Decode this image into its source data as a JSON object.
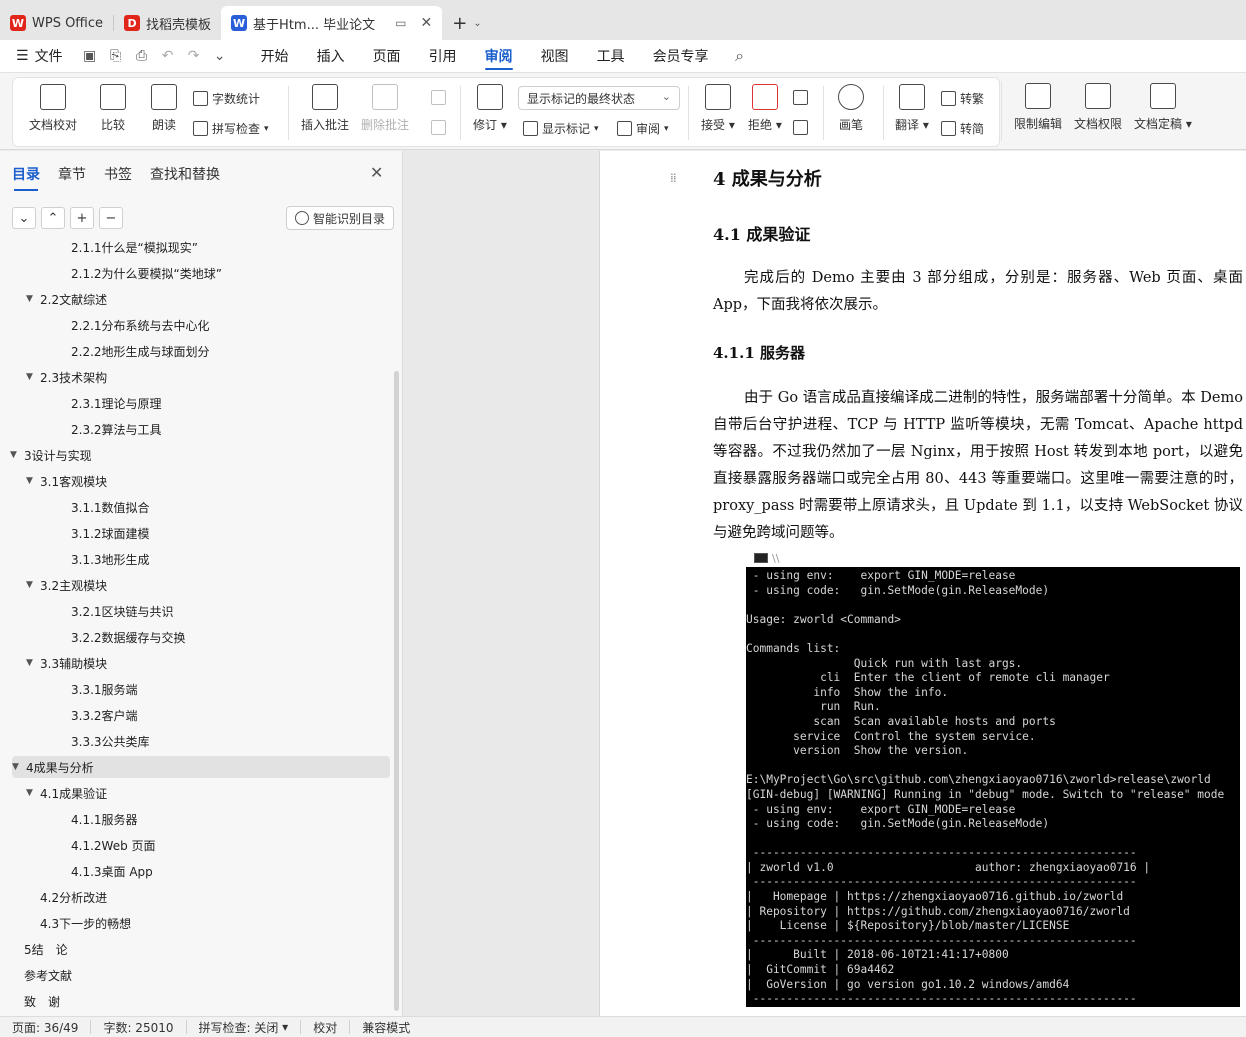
{
  "tabs": [
    {
      "label": "WPS Office",
      "logo": "W",
      "logo_color": "#e1251b"
    },
    {
      "label": "找稻壳模板",
      "logo": "D",
      "logo_color": "#e1251b"
    },
    {
      "label": "基于Htm... 毕业论文",
      "logo": "W",
      "logo_color": "#2b5fd9"
    }
  ],
  "menu": {
    "file": "文件",
    "items": [
      "开始",
      "插入",
      "页面",
      "引用",
      "审阅",
      "视图",
      "工具",
      "会员专享"
    ],
    "active": "审阅"
  },
  "ribbon": {
    "doc_check": "文档校对",
    "compare": "比较",
    "read_aloud": "朗读",
    "word_count": "字数统计",
    "spell_check": "拼写检查",
    "insert_comment": "插入批注",
    "delete_comment": "删除批注",
    "revise": "修订",
    "markup_state": "显示标记的最终状态",
    "show_markup": "显示标记",
    "review": "审阅",
    "accept": "接受",
    "reject": "拒绝",
    "pen": "画笔",
    "translate": "翻译",
    "to_traditional": "转繁",
    "to_simplified": "转简",
    "restrict_edit": "限制编辑",
    "doc_permission": "文档权限",
    "doc_finalize": "文档定稿"
  },
  "nav": {
    "tabs": [
      "目录",
      "章节",
      "书签",
      "查找和替换"
    ],
    "smart_toc": "智能识别目录",
    "toc": [
      {
        "label": "2.1.1什么是“模拟现实”",
        "level": 3
      },
      {
        "label": "2.1.2为什么要模拟“类地球”",
        "level": 3
      },
      {
        "label": "2.2文献综述",
        "level": 2
      },
      {
        "label": "2.2.1分布系统与去中心化",
        "level": 3
      },
      {
        "label": "2.2.2地形生成与球面划分",
        "level": 3
      },
      {
        "label": "2.3技术架构",
        "level": 2
      },
      {
        "label": "2.3.1理论与原理",
        "level": 3
      },
      {
        "label": "2.3.2算法与工具",
        "level": 3
      },
      {
        "label": "3设计与实现",
        "level": 1
      },
      {
        "label": "3.1客观模块",
        "level": 2
      },
      {
        "label": "3.1.1数值拟合",
        "level": 3
      },
      {
        "label": "3.1.2球面建模",
        "level": 3
      },
      {
        "label": "3.1.3地形生成",
        "level": 3
      },
      {
        "label": "3.2主观模块",
        "level": 2
      },
      {
        "label": "3.2.1区块链与共识",
        "level": 3
      },
      {
        "label": "3.2.2数据缓存与交换",
        "level": 3
      },
      {
        "label": "3.3辅助模块",
        "level": 2
      },
      {
        "label": "3.3.1服务端",
        "level": 3
      },
      {
        "label": "3.3.2客户端",
        "level": 3
      },
      {
        "label": "3.3.3公共类库",
        "level": 3
      },
      {
        "label": "4成果与分析",
        "level": 1
      },
      {
        "label": "4.1成果验证",
        "level": 2
      },
      {
        "label": "4.1.1服务器",
        "level": 3
      },
      {
        "label": "4.1.2Web 页面",
        "level": 3
      },
      {
        "label": "4.1.3桌面 App",
        "level": 3
      },
      {
        "label": "4.2分析改进",
        "level": 2
      },
      {
        "label": "4.3下一步的畅想",
        "level": 2
      },
      {
        "label": "5结　论",
        "level": 1
      },
      {
        "label": "参考文献",
        "level": 1
      },
      {
        "label": "致　谢",
        "level": 1
      }
    ]
  },
  "doc": {
    "h1": "4  成果与分析",
    "h2": "4.1  成果验证",
    "p1": "完成后的 Demo 主要由 3 部分组成，分别是：服务器、Web 页面、桌面 App，下面我将依次展示。",
    "h3": "4.1.1  服务器",
    "p2": "由于 Go 语言成品直接编译成二进制的特性，服务端部署十分简单。本 Demo 自带后台守护进程、TCP 与 HTTP 监听等模块，无需 Tomcat、Apache httpd 等容器。不过我仍然加了一层 Nginx，用于按照 Host 转发到本地 port，以避免直接暴露服务器端口或完全占用 80、443 等重要端口。这里唯一需要注意的时，proxy_pass 时需要带上原请求头，且 Update 到 1.1，以支持 WebSocket 协议与避免跨域问题等。",
    "terminal_title": "\\\\",
    "terminal": " - using env:    export GIN_MODE=release\n - using code:   gin.SetMode(gin.ReleaseMode)\n\nUsage: zworld <Command>\n\nCommands list:\n                Quick run with last args.\n           cli  Enter the client of remote cli manager\n          info  Show the info.\n           run  Run.\n          scan  Scan available hosts and ports\n       service  Control the system service.\n       version  Show the version.\n\nE:\\MyProject\\Go\\src\\github.com\\zhengxiaoyao0716\\zworld>release\\zworld\n[GIN-debug] [WARNING] Running in \"debug\" mode. Switch to \"release\" mode\n - using env:    export GIN_MODE=release\n - using code:   gin.SetMode(gin.ReleaseMode)\n\n ---------------------------------------------------------\n| zworld v1.0                     author: zhengxiaoyao0716 |\n ---------------------------------------------------------\n|   Homepage | https://zhengxiaoyao0716.github.io/zworld\n| Repository | https://github.com/zhengxiaoyao0716/zworld\n|    License | ${Repository}/blob/master/LICENSE\n ---------------------------------------------------------\n|      Built | 2018-06-10T21:41:17+0800\n|  GitCommit | 69a4462\n|  GoVersion | go version go1.10.2 windows/amd64\n ---------------------------------------------------------"
  },
  "status": {
    "page": "页面: 36/49",
    "words": "字数: 25010",
    "spell": "拼写检查: 关闭",
    "proofread": "校对",
    "compat": "兼容模式"
  },
  "colors": {
    "accent": "#1a5fcc"
  }
}
